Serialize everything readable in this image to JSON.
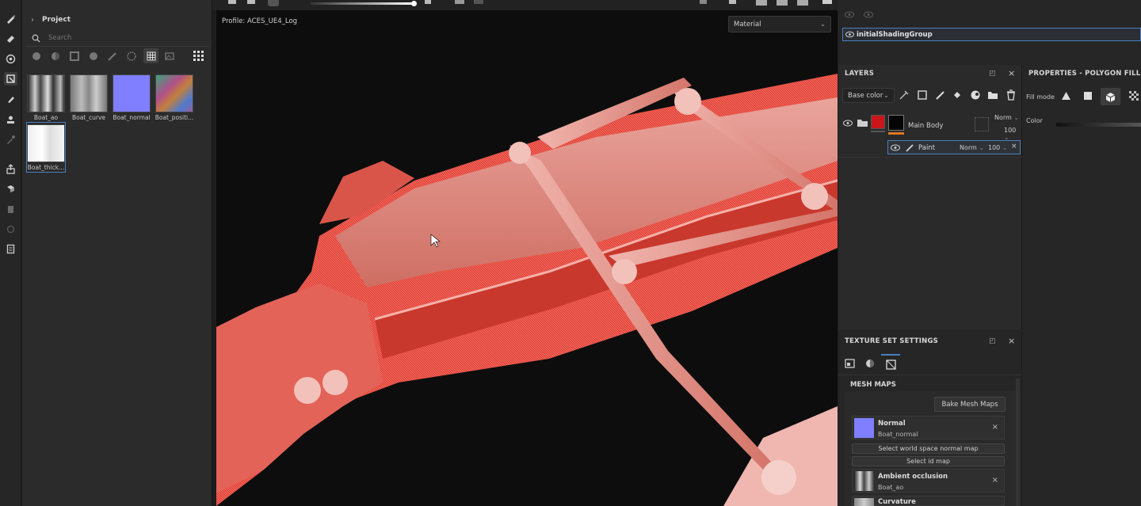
{
  "assets": {
    "project_label": "Project",
    "search_placeholder": "Search",
    "thumbnails": [
      {
        "label": "Boat_ao"
      },
      {
        "label": "Boat_curve"
      },
      {
        "label": "Boat_normal"
      },
      {
        "label": "Boat_positi..."
      },
      {
        "label": "Boat_thick..."
      }
    ]
  },
  "viewport": {
    "profile": "Profile: ACES_UE4_Log",
    "mode_dropdown": "Material"
  },
  "texture_set_list": {
    "shading_group": "initialShadingGroup"
  },
  "layers": {
    "title": "LAYERS",
    "channel_dropdown": "Base color",
    "items": [
      {
        "name": "Main Body",
        "blend": "Norm",
        "opacity": "100"
      },
      {
        "name": "Paint",
        "blend": "Norm",
        "opacity": "100"
      }
    ]
  },
  "properties": {
    "title": "PROPERTIES - POLYGON FILL",
    "fill_mode_label": "Fill mode",
    "color_label": "Color"
  },
  "texture_set_settings": {
    "title": "TEXTURE SET SETTINGS",
    "mesh_maps_label": "MESH MAPS",
    "bake_button": "Bake Mesh Maps",
    "maps": [
      {
        "name": "Normal",
        "file": "Boat_normal"
      },
      {
        "name": "Ambient occlusion",
        "file": "Boat_ao"
      },
      {
        "name": "Curvature",
        "file": ""
      }
    ],
    "select_world_space": "Select world space normal map",
    "select_id_map": "Select id map"
  },
  "colors": {
    "accent": "#4a7fc1",
    "layer_red": "#c8161a",
    "normal_swatch": "#7f7fff",
    "mesh_red": "#e8483c"
  }
}
